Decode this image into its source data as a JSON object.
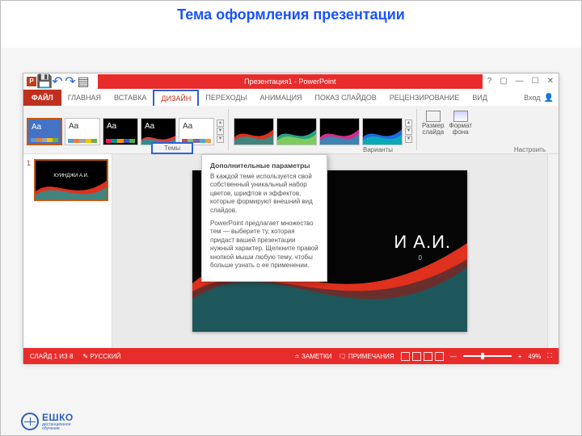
{
  "page_title": "Тема оформления презентации",
  "titlebar": {
    "document": "Презентация1",
    "app": "PowerPoint"
  },
  "tabs": {
    "file": "ФАЙЛ",
    "items": [
      "ГЛАВНАЯ",
      "ВСТАВКА",
      "ДИЗАЙН",
      "ПЕРЕХОДЫ",
      "АНИМАЦИЯ",
      "ПОКАЗ СЛАЙДОВ",
      "РЕЦЕНЗИРОВАНИЕ",
      "ВИД"
    ],
    "active_index": 2,
    "login": "Вход"
  },
  "ribbon": {
    "themes_label": "Темы",
    "variants_label": "Варианты",
    "aa": "Aa",
    "setup": {
      "size": "Размер\nслайда",
      "format": "Формат\nфона",
      "group": "Настроить"
    }
  },
  "thumb": {
    "num": "1",
    "title": "КУИНДЖИ А.И."
  },
  "slide": {
    "title_fragment": "И А.И.",
    "sub_fragment": "0"
  },
  "tooltip": {
    "title": "Дополнительные параметры",
    "p1": "В каждой теме используется свой собственный уникальный набор цветов, шрифтов и эффектов, которые формируют внешний вид слайдов.",
    "p2": "PowerPoint предлагает множество тем — выберите ту, которая придаст вашей презентации нужный характер. Щелкните правой кнопкой мыши любую тему, чтобы больше узнать о ее применении."
  },
  "status": {
    "slide": "СЛАЙД 1 ИЗ 8",
    "lang": "РУССКИЙ",
    "notes_btn": "ЗАМЕТКИ",
    "comments_btn": "ПРИМЕЧАНИЯ",
    "zoom": "49%"
  },
  "footer": {
    "brand": "ЕШКО",
    "sub1": "дистанционное",
    "sub2": "обучение"
  }
}
